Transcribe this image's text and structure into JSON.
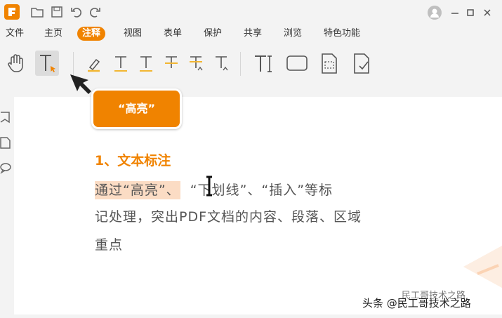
{
  "menu": {
    "items": [
      "文件",
      "主页",
      "注释",
      "视图",
      "表单",
      "保护",
      "共享",
      "浏览",
      "特色功能"
    ],
    "active_index": 2
  },
  "callout": {
    "label": "“高亮”"
  },
  "document": {
    "heading": "1、文本标注",
    "line1_highlighted": "通过“高亮”、",
    "line1_rest": "“下划线”、“插入”等标",
    "line2": "记处理，突出PDF文档的内容、段落、区域",
    "line3": "重点"
  },
  "watermark": {
    "main": "头条 @民工哥技术之路",
    "sub": "民工哥技术之路"
  },
  "colors": {
    "accent": "#f08300",
    "highlight": "#fbdcc4",
    "tool_selected": "#dcdcdc"
  },
  "icons": {
    "titlebar": [
      "folder-open-icon",
      "save-icon",
      "undo-icon",
      "redo-icon"
    ],
    "window": [
      "user-avatar-icon",
      "minimize-icon",
      "maximize-icon",
      "close-icon"
    ],
    "tools": [
      "hand-tool-icon",
      "select-text-icon",
      "highlighter-icon",
      "underline-text-icon",
      "squiggly-text-icon",
      "strikeout-text-icon",
      "replace-text-icon",
      "insert-text-icon",
      "typewriter-icon",
      "rectangle-icon",
      "textbox-icon",
      "note-check-icon"
    ],
    "sidebar": [
      "bookmark-icon",
      "page-icon",
      "comment-icon"
    ]
  }
}
